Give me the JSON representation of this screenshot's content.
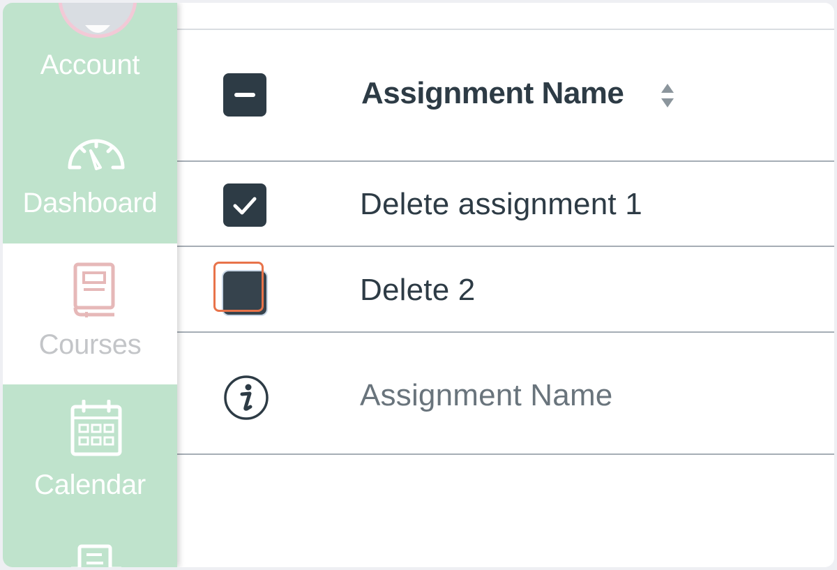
{
  "sidebar": {
    "items": [
      {
        "label": "Account",
        "icon": "account-avatar-icon",
        "active": false
      },
      {
        "label": "Dashboard",
        "icon": "dashboard-gauge-icon",
        "active": false
      },
      {
        "label": "Courses",
        "icon": "courses-book-icon",
        "active": true
      },
      {
        "label": "Calendar",
        "icon": "calendar-icon",
        "active": false
      },
      {
        "label": "",
        "icon": "inbox-icon",
        "active": false
      }
    ],
    "colors": {
      "background": "#bfe3cc",
      "active_background": "#ffffff",
      "active_icon": "#e6b8b8"
    }
  },
  "table": {
    "header": {
      "column_name": "Assignment Name",
      "select_all_state": "indeterminate",
      "sort_icon": "sort-up-down-icon"
    },
    "rows": [
      {
        "name": "Delete assignment 1",
        "checked": true
      },
      {
        "name": "Delete 2",
        "checked": false,
        "focused": true
      }
    ],
    "info_row": {
      "icon": "info-icon",
      "text": "Assignment Name"
    }
  },
  "colors": {
    "checkbox": "#2d3b45",
    "focus_ring": "#e8734a",
    "text": "#2d3b45"
  }
}
